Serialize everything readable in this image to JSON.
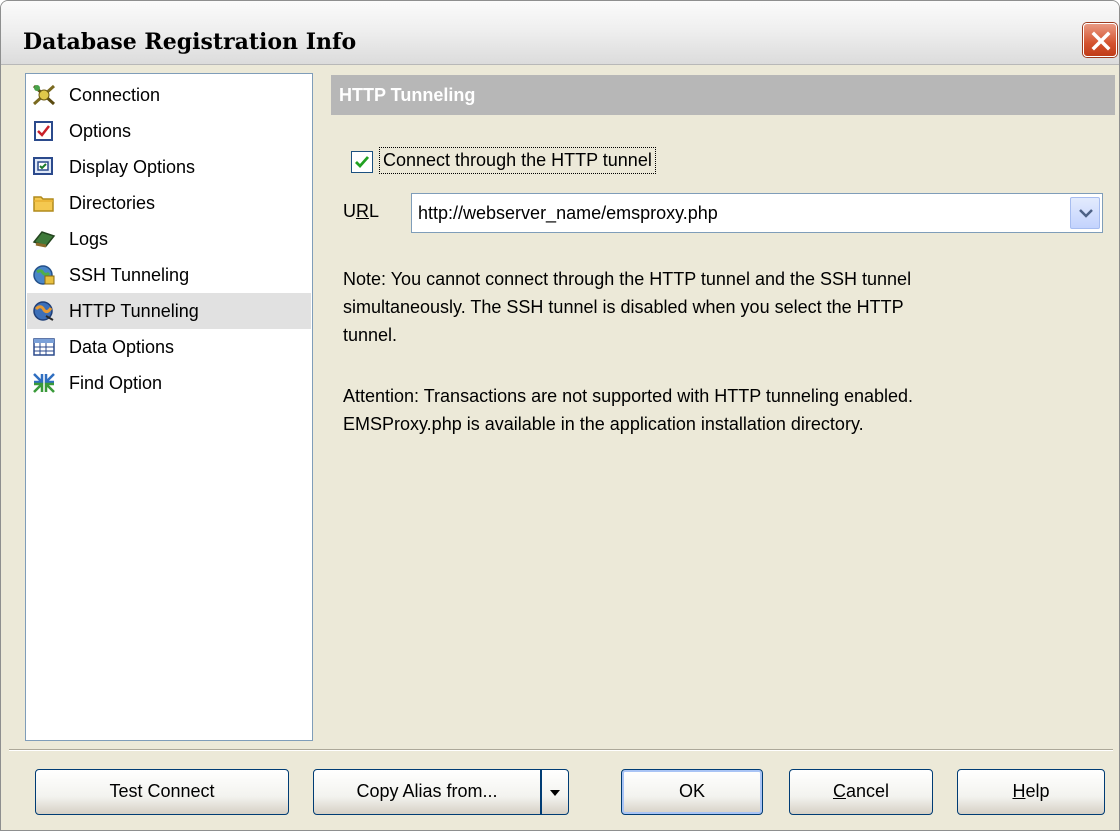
{
  "window": {
    "title": "Database Registration Info"
  },
  "nav": {
    "items": [
      {
        "label": "Connection",
        "icon": "connection-icon"
      },
      {
        "label": "Options",
        "icon": "options-icon"
      },
      {
        "label": "Display Options",
        "icon": "display-options-icon"
      },
      {
        "label": "Directories",
        "icon": "folder-icon"
      },
      {
        "label": "Logs",
        "icon": "logs-icon"
      },
      {
        "label": "SSH Tunneling",
        "icon": "ssh-tunneling-icon"
      },
      {
        "label": "HTTP Tunneling",
        "icon": "http-tunneling-icon",
        "selected": true
      },
      {
        "label": "Data Options",
        "icon": "data-options-icon"
      },
      {
        "label": "Find Option",
        "icon": "find-option-icon"
      }
    ]
  },
  "panel": {
    "header": "HTTP Tunneling",
    "checkbox": {
      "label": "Connect through the HTTP tunnel",
      "checked": true
    },
    "url": {
      "label_prefix": "U",
      "label_underlined": "R",
      "label_suffix": "L",
      "value": "http://webserver_name/emsproxy.php"
    },
    "note_lines": [
      "Note: You cannot connect through the HTTP tunnel and the SSH tunnel",
      "simultaneously. The SSH tunnel is disabled  when you select the HTTP",
      "tunnel."
    ],
    "attention_lines": [
      "Attention: Transactions are not supported with HTTP tunneling enabled.",
      "EMSProxy.php is available in the application installation directory."
    ]
  },
  "buttons": {
    "test_connect": "Test Connect",
    "copy_alias": "Copy Alias from...",
    "ok": "OK",
    "cancel_underlined": "C",
    "cancel_rest": "ancel",
    "help_underlined": "H",
    "help_rest": "elp"
  },
  "colors": {
    "accent": "#003c74",
    "header_bg": "#b7b7b7",
    "window_bg": "#ece9d8",
    "close_button": "#d4532f"
  }
}
